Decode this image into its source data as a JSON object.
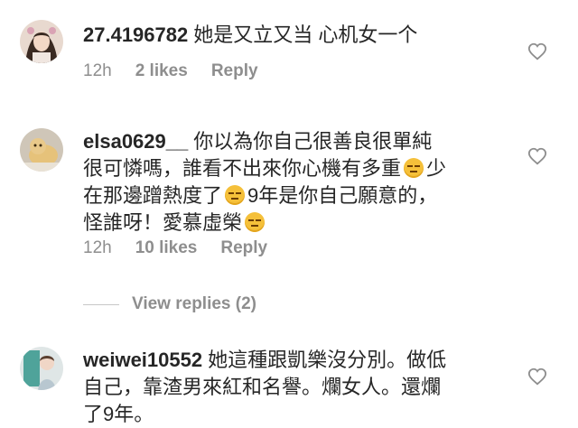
{
  "comments": [
    {
      "username": "27.4196782",
      "text": "她是又立又当 心机女一个",
      "time": "12h",
      "likes": "2 likes",
      "reply": "Reply",
      "avatar_icon": "user-avatar-photo",
      "heart_icon": "heart-outline-icon"
    },
    {
      "username": "elsa0629__",
      "text_line1": "你以為你自己很善良很單純",
      "text_line2a": "很可憐嗎，誰看不出來你心機有多重",
      "text_line2b": "少",
      "text_line3a": "在那邊蹭熱度了",
      "text_line3b": "9年是你自己願意的，",
      "text_line4": "怪誰呀！愛慕虛榮",
      "time": "12h",
      "likes": "10 likes",
      "reply": "Reply",
      "emoji_icon": "expressionless-face-emoji",
      "heart_icon": "heart-outline-icon"
    },
    {
      "username": "weiwei10552",
      "text_line1": "她這種跟凱樂沒分別。做低",
      "text_line2": "自己，靠渣男來紅和名譽。爛女人。還爛",
      "text_line3": "了9年。",
      "heart_icon": "heart-outline-icon"
    }
  ],
  "view_replies": "View replies (2)",
  "colors": {
    "text": "#262626",
    "secondary": "#8e8e8e",
    "divider": "#c7c7c7"
  }
}
